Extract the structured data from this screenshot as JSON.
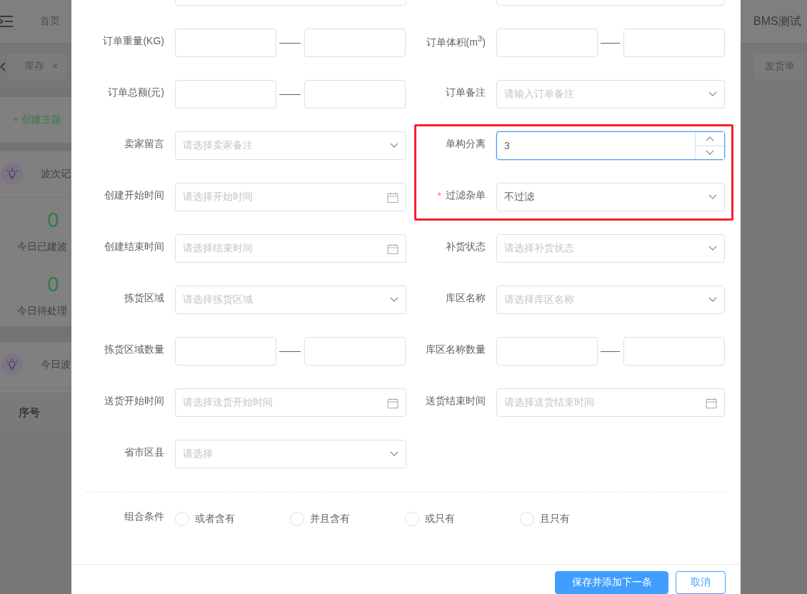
{
  "background": {
    "nav": "首页",
    "user": "BMS测试",
    "left_tab": {
      "label": "库存",
      "close": "×"
    },
    "right_tab": {
      "label": "发货单"
    },
    "create_topic": "+ 创建主题",
    "panels": [
      {
        "title": "波次记",
        "stats": [
          {
            "value": "0",
            "label": "今日已建波"
          },
          {
            "value": "0",
            "label": "今日待处理"
          }
        ]
      },
      {
        "title": "今日波"
      }
    ],
    "table_header": "序号"
  },
  "dialog": {
    "rows": [
      {
        "left": {
          "kind": "blank"
        },
        "right": {
          "kind": "blank"
        }
      },
      {
        "left": {
          "label": "订单重量(KG)",
          "kind": "range"
        },
        "right": {
          "label": "订单体积(m$^{3}$)",
          "kind": "range"
        }
      },
      {
        "left": {
          "label": "订单总额(元)",
          "kind": "range"
        },
        "right": {
          "label": "订单备注",
          "kind": "select",
          "placeholder": "请输入订单备注"
        }
      },
      {
        "left": {
          "label": "卖家留言",
          "kind": "select",
          "placeholder": "请选择卖家备注"
        },
        "right": {
          "label": "单构分离",
          "kind": "number",
          "value": "3",
          "highlighted": true,
          "focused": true
        }
      },
      {
        "left": {
          "label": "创建开始时间",
          "kind": "date",
          "placeholder": "请选择开始时间"
        },
        "right": {
          "label": "过滤杂单",
          "required_mark": "*",
          "kind": "select",
          "value": "不过滤",
          "highlighted": true
        }
      },
      {
        "left": {
          "label": "创建结束时间",
          "kind": "date",
          "placeholder": "请选择结束时间"
        },
        "right": {
          "label": "补货状态",
          "kind": "select",
          "placeholder": "请选择补货状态"
        }
      },
      {
        "left": {
          "label": "拣货区域",
          "kind": "select",
          "placeholder": "请选择拣货区域"
        },
        "right": {
          "label": "库区名称",
          "kind": "select",
          "placeholder": "请选择库区名称"
        }
      },
      {
        "left": {
          "label": "拣货区域数量",
          "kind": "range"
        },
        "right": {
          "label": "库区名称数量",
          "kind": "range"
        }
      },
      {
        "left": {
          "label": "送货开始时间",
          "kind": "date",
          "placeholder": "请选择送货开始时间"
        },
        "right": {
          "label": "送货结束时间",
          "kind": "date",
          "placeholder": "请选择送货结束时间"
        }
      },
      {
        "left": {
          "label": "省市区县",
          "kind": "select",
          "placeholder": "请选择"
        }
      }
    ],
    "combine": {
      "label": "组合条件",
      "options": [
        {
          "label": "或者含有",
          "selected": false
        },
        {
          "label": "并且含有",
          "selected": false
        },
        {
          "label": "或只有",
          "selected": false
        },
        {
          "label": "且只有",
          "selected": false
        }
      ]
    },
    "buttons": [
      {
        "label": "保存并添加下一条",
        "kind": "primary"
      },
      {
        "label": "取消",
        "kind": "default"
      }
    ]
  }
}
